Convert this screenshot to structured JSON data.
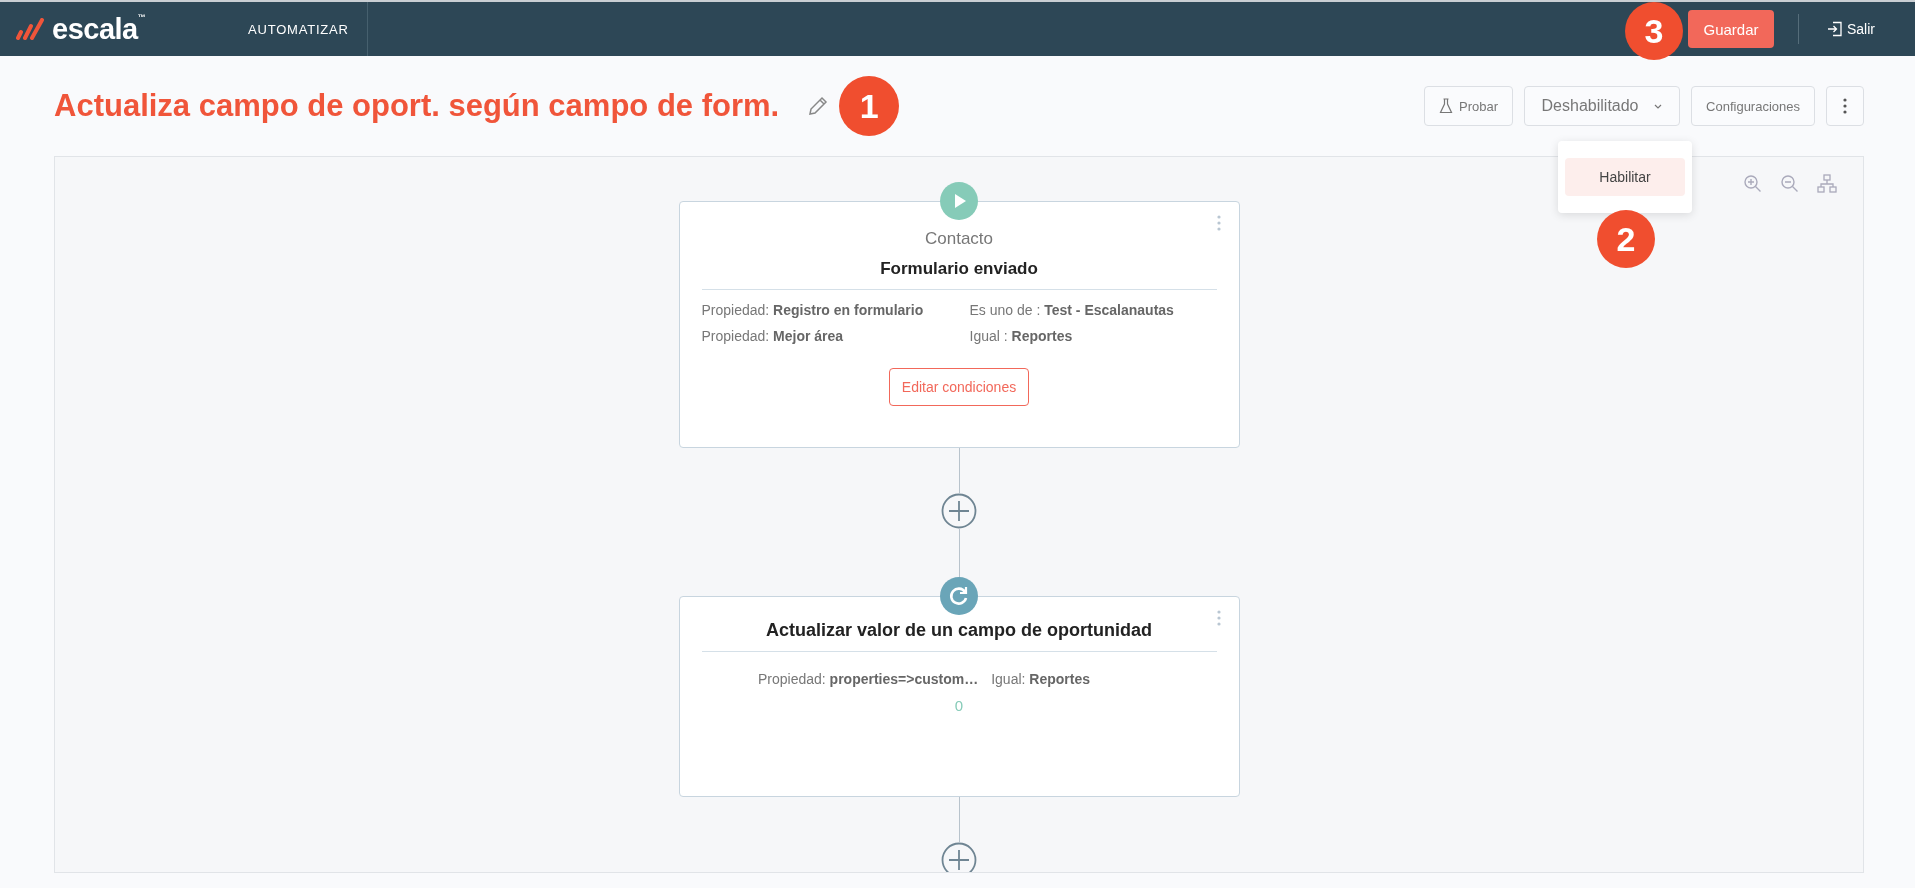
{
  "top_bar": {
    "logo": "escala",
    "trademark": "™",
    "nav_item": "AUTOMATIZAR",
    "save_button": "Guardar",
    "logout": "Salir"
  },
  "title": "Actualiza campo de oport. según campo de form.",
  "toolbar": {
    "test_button": "Probar",
    "status_dropdown": {
      "value": "Deshabilitado",
      "expanded": true,
      "options": [
        "Habilitar"
      ]
    },
    "settings_button": "Configuraciones"
  },
  "annotations": [
    {
      "label": "1"
    },
    {
      "label": "2"
    },
    {
      "label": "3"
    }
  ],
  "nodes": [
    {
      "kind": "trigger",
      "category": "Contacto",
      "title": "Formulario enviado",
      "conditions": [
        "Propiedad: **Registro en formulario**",
        "Es uno de : **Test - Escalanautas**",
        "Propiedad: **Mejor área**",
        "Igual : **Reportes**"
      ],
      "button": "Editar condiciones"
    },
    {
      "kind": "action",
      "title": "Actualizar valor de un campo de oportunidad",
      "conditions": [
        "Propiedad: **properties=>custom…**",
        "Igual: **Reportes**"
      ],
      "value": "0"
    }
  ]
}
